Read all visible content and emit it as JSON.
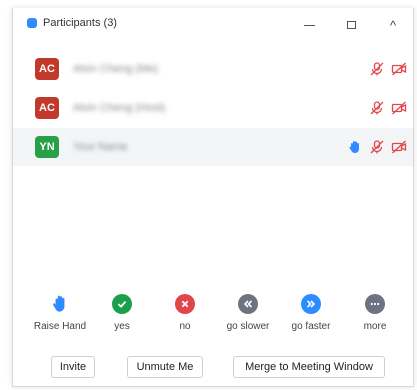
{
  "window": {
    "title": "Participants (3)",
    "close_glyph": "^"
  },
  "participants": [
    {
      "initials": "AC",
      "name": "Alvin Cheng (Me)",
      "avatar_color": "#c0392b",
      "raised_hand": false,
      "mic": "muted",
      "video": "off"
    },
    {
      "initials": "AC",
      "name": "Alvin Cheng (Host)",
      "avatar_color": "#c0392b",
      "raised_hand": false,
      "mic": "muted",
      "video": "off"
    },
    {
      "initials": "YN",
      "name": "Your Name",
      "avatar_color": "#27a047",
      "raised_hand": true,
      "mic": "muted",
      "video": "off"
    }
  ],
  "reactions": [
    {
      "label": "Raise Hand",
      "icon": "raise-hand-icon",
      "color": "#2d8cff"
    },
    {
      "label": "yes",
      "icon": "check-icon",
      "color": "#1aa04c"
    },
    {
      "label": "no",
      "icon": "x-icon",
      "color": "#e0464a"
    },
    {
      "label": "go slower",
      "icon": "rewind-icon",
      "color": "#6d7380"
    },
    {
      "label": "go faster",
      "icon": "fast-forward-icon",
      "color": "#2d8cff"
    },
    {
      "label": "more",
      "icon": "more-icon",
      "color": "#6d7380"
    }
  ],
  "buttons": {
    "invite": "Invite",
    "unmute": "Unmute Me",
    "merge": "Merge to Meeting Window"
  },
  "colors": {
    "muted_icon": "#e0464a",
    "hand_icon": "#2d8cff"
  }
}
